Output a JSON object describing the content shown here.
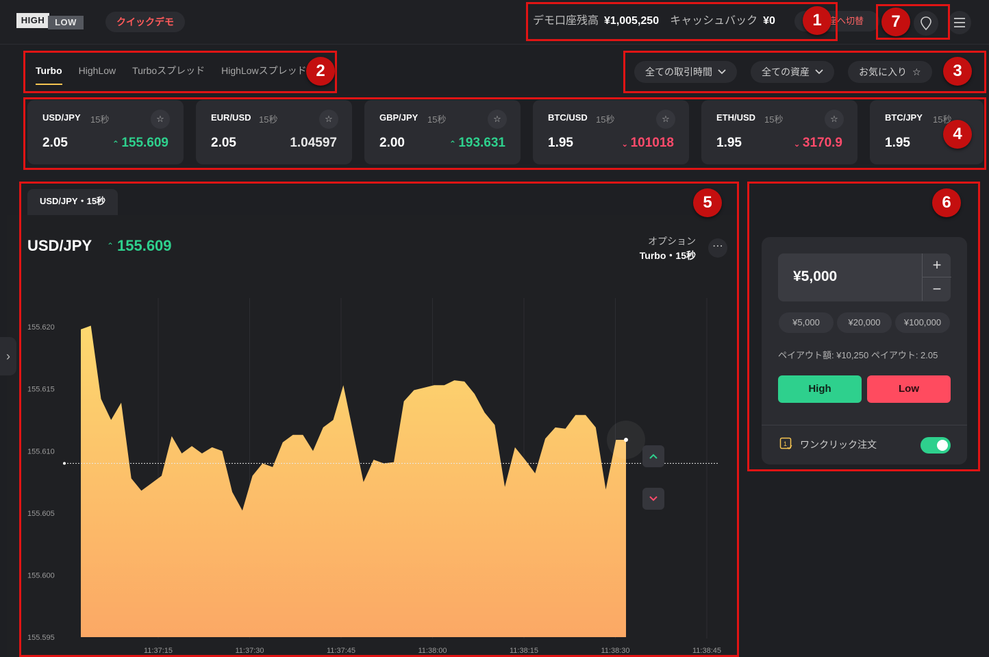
{
  "header": {
    "logo_high": "HIGH",
    "logo_low": "LOW",
    "quick_demo": "クイックデモ",
    "balance_label": "デモ口座残高",
    "balance_value": "¥1,005,250",
    "cashback_label": "キャッシュバック",
    "cashback_value": "¥0",
    "switch_account": "本口座へ切替"
  },
  "tabs": [
    "Turbo",
    "HighLow",
    "Turboスプレッド",
    "HighLowスプレッド"
  ],
  "filters": {
    "trading_time": "全ての取引時間",
    "assets": "全ての資産",
    "favorites": "お気に入り"
  },
  "assets": [
    {
      "pair": "USD/JPY",
      "duration": "15秒",
      "payout": "2.05",
      "price": "155.609",
      "trend": "up"
    },
    {
      "pair": "EUR/USD",
      "duration": "15秒",
      "payout": "2.05",
      "price": "1.04597",
      "trend": "flat"
    },
    {
      "pair": "GBP/JPY",
      "duration": "15秒",
      "payout": "2.00",
      "price": "193.631",
      "trend": "up"
    },
    {
      "pair": "BTC/USD",
      "duration": "15秒",
      "payout": "1.95",
      "price": "101018",
      "trend": "down"
    },
    {
      "pair": "ETH/USD",
      "duration": "15秒",
      "payout": "1.95",
      "price": "3170.9",
      "trend": "down"
    },
    {
      "pair": "BTC/JPY",
      "duration": "15秒",
      "payout": "1.95",
      "price": "",
      "trend": "flat"
    }
  ],
  "chart_panel": {
    "tab_label": "USD/JPY・15秒",
    "symbol": "USD/JPY",
    "price": "155.609",
    "option_label": "オプション",
    "option_value": "Turbo・15秒"
  },
  "trade": {
    "amount": "¥5,000",
    "presets": [
      "¥5,000",
      "¥20,000",
      "¥100,000"
    ],
    "payout_info": "ペイアウト額: ¥10,250  ペイアウト: 2.05",
    "high_label": "High",
    "low_label": "Low",
    "one_click_label": "ワンクリック注文",
    "one_click_enabled": true
  },
  "annotations": [
    "1",
    "2",
    "3",
    "4",
    "5",
    "6",
    "7"
  ],
  "colors": {
    "up": "#2ed08d",
    "down": "#ff4b6b",
    "accent": "#f5c451",
    "annotation": "#e01414"
  },
  "chart_data": {
    "type": "area",
    "x": [
      "11:37:09",
      "11:37:12",
      "11:37:13",
      "11:37:16",
      "11:37:19",
      "11:37:23",
      "11:37:25",
      "11:37:28",
      "11:37:32",
      "11:37:33",
      "11:37:36",
      "11:37:38",
      "11:37:41",
      "11:37:44",
      "11:37:46",
      "11:37:47",
      "11:37:49",
      "11:37:51",
      "11:37:53",
      "11:37:55",
      "11:37:57",
      "11:38:00",
      "11:38:01",
      "11:38:03",
      "11:38:05",
      "11:38:06",
      "11:38:08",
      "11:38:11",
      "11:38:13",
      "11:38:14",
      "11:38:16",
      "11:38:18",
      "11:38:21",
      "11:38:23",
      "11:38:25",
      "11:38:27",
      "11:38:29",
      "11:38:30"
    ],
    "values": [
      155.6198,
      155.6201,
      155.6142,
      155.6125,
      155.6139,
      155.6078,
      155.6068,
      155.6074,
      155.608,
      155.6112,
      155.6098,
      155.6104,
      155.6098,
      155.6103,
      155.61,
      155.6067,
      155.6052,
      155.608,
      155.609,
      155.6087,
      155.6107,
      155.6113,
      155.6113,
      155.61,
      155.6119,
      155.6125,
      155.6153,
      155.6114,
      155.6075,
      155.6093,
      155.609,
      155.6091,
      155.614,
      155.6149,
      155.6151,
      155.6153,
      155.6153,
      155.6157,
      155.6156,
      155.6146,
      155.6131,
      155.6121,
      155.6071,
      155.6103,
      155.6093,
      155.6082,
      155.611,
      155.6119,
      155.6118,
      155.6129,
      155.6129,
      155.6119,
      155.6069,
      155.6109,
      155.6109
    ],
    "series": [
      {
        "name": "USD/JPY",
        "values": []
      }
    ],
    "current_price_line": 155.609,
    "xticks": [
      "11:37:15",
      "11:37:30",
      "11:37:45",
      "11:38:00",
      "11:38:15",
      "11:38:30",
      "11:38:45"
    ],
    "yticks": [
      "155.620",
      "155.615",
      "155.610",
      "155.605",
      "155.600",
      "155.595"
    ],
    "ylim": [
      155.595,
      155.6215
    ],
    "xlim_seconds": [
      0,
      98
    ],
    "grid": true,
    "title": "",
    "xlabel": "",
    "ylabel": ""
  }
}
